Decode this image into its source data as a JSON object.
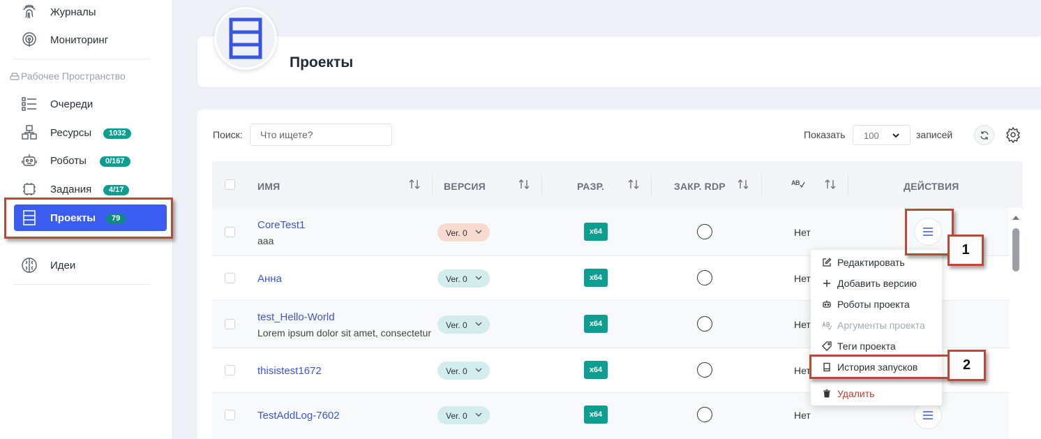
{
  "sidebar": {
    "items_top": [
      {
        "label": "Журналы",
        "icon": "fingerprint-icon"
      },
      {
        "label": "Мониторинг",
        "icon": "monitoring-icon"
      }
    ],
    "section_label": "Рабочее Пространство",
    "items": [
      {
        "label": "Очереди",
        "icon": "queue-list-icon",
        "badge": ""
      },
      {
        "label": "Ресурсы",
        "icon": "resources-icon",
        "badge": "1032"
      },
      {
        "label": "Роботы",
        "icon": "robot-icon",
        "badge": "0/167"
      },
      {
        "label": "Задания",
        "icon": "tasks-icon",
        "badge": "4/17"
      },
      {
        "label": "Проекты",
        "icon": "projects-icon",
        "badge": "79",
        "active": true
      }
    ],
    "items_bottom": [
      {
        "label": "Идеи",
        "icon": "brain-icon"
      }
    ]
  },
  "header": {
    "title": "Проекты",
    "icon": "projects-icon"
  },
  "toolbar": {
    "search_label": "Поиск:",
    "search_placeholder": "Что ищете?",
    "show_label": "Показать",
    "page_size": "100",
    "records_label": "записей"
  },
  "table": {
    "columns": [
      "ИМЯ",
      "ВЕРСИЯ",
      "РАЗР.",
      "ЗАКР. RDP",
      "AB",
      "ДЕЙСТВИЯ"
    ],
    "rows": [
      {
        "name": "CoreTest1",
        "desc": "aaa",
        "version": "Ver. 0",
        "arch": "x64",
        "flag": "Нет"
      },
      {
        "name": "Анна",
        "desc": "",
        "version": "Ver. 0",
        "arch": "x64",
        "flag": "Нет"
      },
      {
        "name": "test_Hello-World",
        "desc": "Lorem ipsum dolor sit amet, consectetur",
        "version": "Ver. 0",
        "arch": "x64",
        "flag": "Нет"
      },
      {
        "name": "thisistest1672",
        "desc": "",
        "version": "Ver. 0",
        "arch": "x64",
        "flag": "Нет"
      },
      {
        "name": "TestAddLog-7602",
        "desc": "",
        "version": "Ver. 0",
        "arch": "x64",
        "flag": "Нет"
      }
    ]
  },
  "menu": {
    "items": [
      {
        "label": "Редактировать",
        "icon": "edit-icon"
      },
      {
        "label": "Добавить версию",
        "icon": "plus-icon"
      },
      {
        "label": "Роботы проекта",
        "icon": "robot-icon"
      },
      {
        "label": "Аргументы проекта",
        "icon": "arguments-icon",
        "disabled": true
      },
      {
        "label": "Теги проекта",
        "icon": "tag-icon"
      },
      {
        "label": "История запусков",
        "icon": "history-icon"
      },
      {
        "label": "Удалить",
        "icon": "trash-icon",
        "danger": true
      }
    ]
  },
  "annotations": {
    "step1": "1",
    "step2": "2"
  },
  "colors": {
    "accent": "#3a5cf0",
    "teal": "#0e9d91",
    "callout": "#b84a38",
    "link": "#3c55d4"
  }
}
